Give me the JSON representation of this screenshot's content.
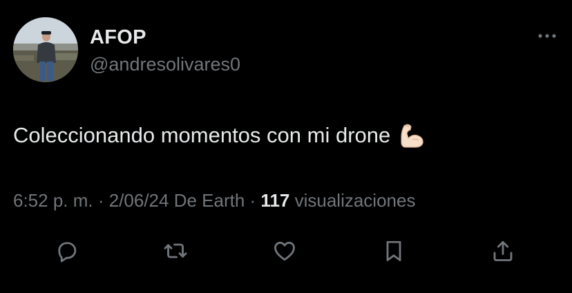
{
  "user": {
    "display_name": "AFOP",
    "handle": "@andresolivares0"
  },
  "tweet": {
    "text": "Coleccionando momentos con mi drone",
    "emoji": "flexed-biceps"
  },
  "meta": {
    "time": "6:52 p. m.",
    "sep1": " · ",
    "date_source": "2/06/24 De Earth",
    "sep2": " · ",
    "views_count": "117",
    "views_label": " visualizaciones"
  },
  "actions": [
    {
      "name": "reply",
      "icon": "reply-icon"
    },
    {
      "name": "repost",
      "icon": "repost-icon"
    },
    {
      "name": "like",
      "icon": "heart-icon"
    },
    {
      "name": "bookmark",
      "icon": "bookmark-icon"
    },
    {
      "name": "share",
      "icon": "share-icon"
    }
  ],
  "colors": {
    "background": "#000000",
    "text_primary": "#e7e9ea",
    "text_secondary": "#71767b"
  }
}
